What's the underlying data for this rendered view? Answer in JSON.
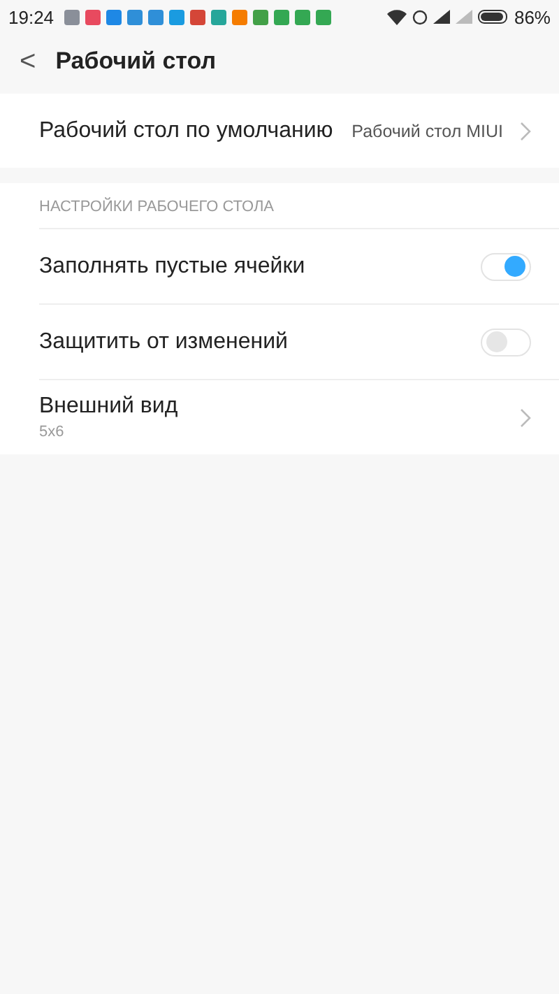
{
  "status_bar": {
    "time": "19:24",
    "battery": "86%"
  },
  "header": {
    "back": "<",
    "title": "Рабочий стол"
  },
  "default_launcher": {
    "label": "Рабочий стол по умолчанию",
    "value": "Рабочий стол MIUI"
  },
  "section": {
    "title": "НАСТРОЙКИ РАБОЧЕГО СТОЛА",
    "rows": [
      {
        "kind": "toggle",
        "label": "Заполнять пустые ячейки",
        "on": true
      },
      {
        "kind": "toggle",
        "label": "Защитить от изменений",
        "on": false
      },
      {
        "kind": "link",
        "label": "Внешний вид",
        "subtitle": "5x6"
      }
    ]
  }
}
